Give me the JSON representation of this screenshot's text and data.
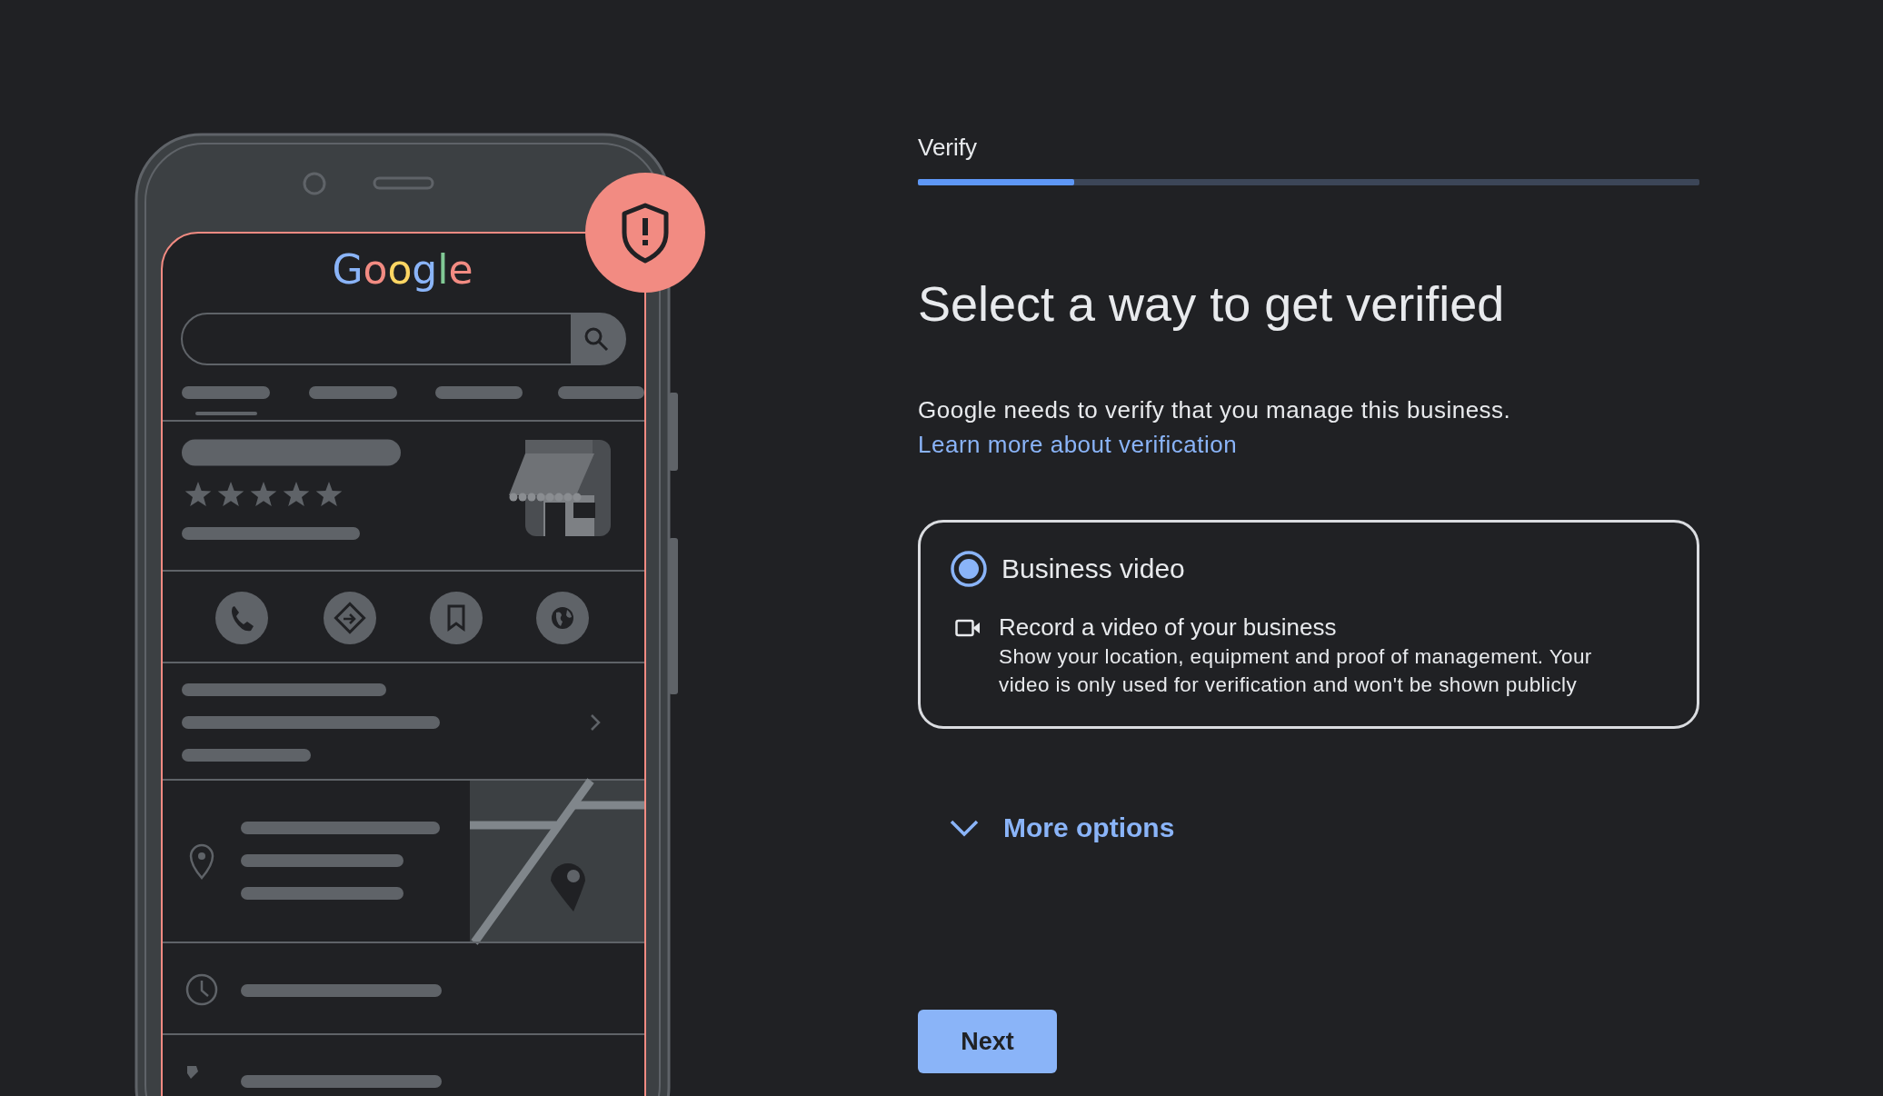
{
  "illustration": {
    "logo": "Google"
  },
  "progress": {
    "label": "Verify",
    "level": 0.2
  },
  "heading": "Select a way to get verified",
  "intro": "Google needs to verify that you manage this business.",
  "link": "Learn more about verification",
  "options": [
    {
      "title": "Business video",
      "selected": true,
      "method": "Record a video of your business",
      "description": "Show your location, equipment and proof of management. Your video is only used for verification and won't be shown publicly"
    }
  ],
  "more_options": {
    "label": "More options",
    "expanded": false
  },
  "next_button": "Next"
}
